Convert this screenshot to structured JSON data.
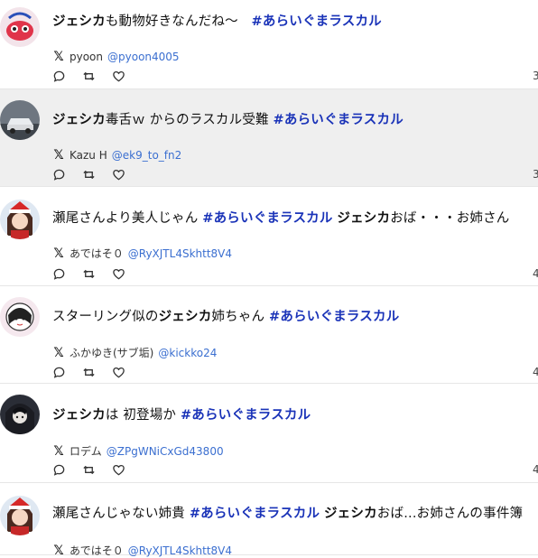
{
  "tweets": [
    {
      "segments": [
        {
          "t": "ジェシカ",
          "s": "b"
        },
        {
          "t": "も動物好きなんだね〜　",
          "s": "n"
        },
        {
          "t": "#あらいぐまラスカル",
          "s": "tag"
        }
      ],
      "name": "pyoon",
      "handle": "@pyoon4005",
      "count": "3",
      "highlight": false
    },
    {
      "segments": [
        {
          "t": "ジェシカ",
          "s": "b"
        },
        {
          "t": "毒舌ｗ からのラスカル受難 ",
          "s": "n"
        },
        {
          "t": "#あらいぐまラスカル",
          "s": "tag"
        }
      ],
      "name": "Kazu H",
      "handle": "@ek9_to_fn2",
      "count": "3",
      "highlight": true
    },
    {
      "segments": [
        {
          "t": "瀬尾さんより美人じゃん ",
          "s": "n"
        },
        {
          "t": "#あらいぐまラスカル",
          "s": "tag"
        },
        {
          "t": " ",
          "s": "n"
        },
        {
          "t": "ジェシカ",
          "s": "b"
        },
        {
          "t": "おば・・・お姉さん",
          "s": "n"
        }
      ],
      "name": "あではそ０",
      "handle": "@RyXJTL4Skhtt8V4",
      "count": "4",
      "highlight": false
    },
    {
      "segments": [
        {
          "t": "スターリング似の",
          "s": "n"
        },
        {
          "t": "ジェシカ",
          "s": "b"
        },
        {
          "t": "姉ちゃん ",
          "s": "n"
        },
        {
          "t": "#あらいぐまラスカル",
          "s": "tag"
        }
      ],
      "name": "ふかゆき(サブ垢)",
      "handle": "@kickko24",
      "count": "4",
      "highlight": false
    },
    {
      "segments": [
        {
          "t": "ジェシカ",
          "s": "b"
        },
        {
          "t": "は 初登場か ",
          "s": "n"
        },
        {
          "t": "#あらいぐまラスカル",
          "s": "tag"
        }
      ],
      "name": "ロデム",
      "handle": "@ZPgWNiCxGd43800",
      "count": "4",
      "highlight": false
    },
    {
      "segments": [
        {
          "t": "瀬尾さんじゃない姉貴 ",
          "s": "n"
        },
        {
          "t": "#あらいぐまラスカル",
          "s": "tag"
        },
        {
          "t": " ",
          "s": "n"
        },
        {
          "t": "ジェシカ",
          "s": "b"
        },
        {
          "t": "おば...お姉さんの事件簿",
          "s": "n"
        }
      ],
      "name": "あではそ０",
      "handle": "@RyXJTL4Skhtt8V4",
      "count": "",
      "highlight": false
    }
  ],
  "icons": {
    "platform": "x-logo-icon",
    "reply": "reply-icon",
    "retweet": "retweet-icon",
    "like": "like-icon"
  },
  "colors": {
    "hashtag": "#1a33b8",
    "handle": "#3b6fd0",
    "highlight": "#efefef"
  }
}
